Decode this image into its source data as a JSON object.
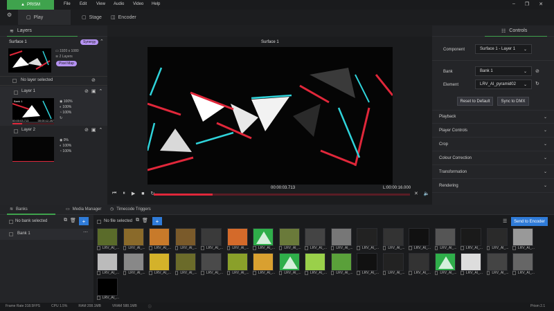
{
  "app": {
    "logo": "PRISM"
  },
  "menu": [
    "File",
    "Edit",
    "View",
    "Audio",
    "Video",
    "Help"
  ],
  "tabs": {
    "play": "Play",
    "stage": "Stage",
    "encoder": "Encoder"
  },
  "left": {
    "layers_title": "Layers",
    "surface": "Surface 1",
    "badge_synergy": "Synergy",
    "surface_res": "1920 x 1080",
    "surface_layers": "2 Layers",
    "badge_pixelmap": "Pixel Map",
    "no_layer": "No layer selected",
    "layer1": "Layer 1",
    "layer1_vals": [
      "100%",
      "100%",
      "100%"
    ],
    "layer1_time_a": "00:00:03.713",
    "layer1_time_b": "00:00:12.287",
    "layer1_thumb_text": "Bank 1",
    "layer2": "Layer 2",
    "layer2_vals": [
      "0%",
      "100%",
      "100%"
    ]
  },
  "viewer": {
    "title": "Surface 1",
    "time_current": "00:00:03.713",
    "time_length": "L:00:00:16.000",
    "progress": 0.23
  },
  "controls": {
    "title": "Controls",
    "component_label": "Component",
    "component_value": "Surface 1 - Layer 1",
    "bank_label": "Bank",
    "bank_value": "Bank 1",
    "element_label": "Element",
    "element_value": "LRV_AI_pyramid02",
    "reset": "Reset to Default",
    "sync": "Sync to DMX",
    "sections": [
      "Playback",
      "Player Controls",
      "Crop",
      "Colour Correction",
      "Transformation",
      "Rendering"
    ]
  },
  "bottom": {
    "tab_banks": "Banks",
    "tab_media": "Media Manager",
    "tab_timecode": "Timecode Triggers",
    "no_bank": "No bank selected",
    "bank1": "Bank 1",
    "no_file": "No file selected",
    "send": "Send to Encoder",
    "thumb_label": "LRV_AI_..."
  },
  "status": {
    "frame_rate": "Frame Rate  318.5FPS",
    "cpu": "CPU  1.5%",
    "ram": "RAM  208.1MB",
    "vram": "VRAM  588.1MB",
    "version": "Prism 2.1"
  },
  "colors": {
    "accent": "#3fa34d",
    "blue": "#2f7bd8",
    "red": "#e0273a",
    "cyan": "#2fd3da"
  }
}
